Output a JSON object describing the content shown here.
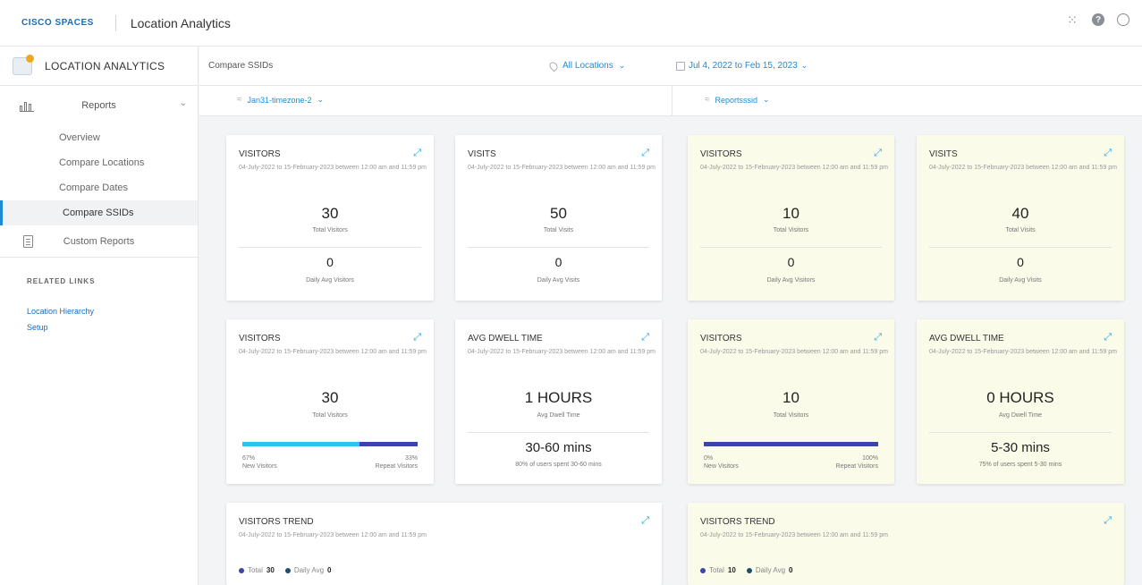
{
  "header": {
    "brand": "CISCO SPACES",
    "app_title": "Location Analytics"
  },
  "sidebar": {
    "title": "LOCATION ANALYTICS",
    "reports_label": "Reports",
    "sub_items": [
      "Overview",
      "Compare Locations",
      "Compare Dates",
      "Compare SSIDs"
    ],
    "active_item": "Compare SSIDs",
    "custom_reports": "Custom Reports",
    "related_links_heading": "RELATED LINKS",
    "links": [
      "Location Hierarchy",
      "Setup"
    ]
  },
  "filters": {
    "page_title": "Compare SSIDs",
    "location": "All Locations",
    "date_range": "Jul 4, 2022 to Feb 15, 2023",
    "ssid_left": "Jan31-timezone-2",
    "ssid_right": "Reportsssid"
  },
  "date_sub": "04-July-2022 to 15-February-2023 between 12:00 am and 11:59 pm",
  "cards_row1": [
    {
      "title": "VISITORS",
      "value": "30",
      "value_label": "Total Visitors",
      "avg": "0",
      "avg_label": "Daily Avg Visitors"
    },
    {
      "title": "VISITS",
      "value": "50",
      "value_label": "Total Visits",
      "avg": "0",
      "avg_label": "Daily Avg Visits"
    },
    {
      "title": "VISITORS",
      "value": "10",
      "value_label": "Total Visitors",
      "avg": "0",
      "avg_label": "Daily Avg Visitors"
    },
    {
      "title": "VISITS",
      "value": "40",
      "value_label": "Total Visits",
      "avg": "0",
      "avg_label": "Daily Avg Visits"
    }
  ],
  "cards_row2": [
    {
      "title": "VISITORS",
      "value": "30",
      "value_label": "Total Visitors",
      "new_pct": "67%",
      "repeat_pct": "33%",
      "new_fraction": 0.67,
      "new_label": "New Visitors",
      "repeat_label": "Repeat Visitors"
    },
    {
      "title": "AVG DWELL TIME",
      "value": "1 HOURS",
      "value_label": "Avg Dwell Time",
      "range": "30-60 mins",
      "range_note": "80% of users spent 30-60 mins"
    },
    {
      "title": "VISITORS",
      "value": "10",
      "value_label": "Total Visitors",
      "new_pct": "0%",
      "repeat_pct": "100%",
      "new_fraction": 0.0,
      "new_label": "New Visitors",
      "repeat_label": "Repeat Visitors"
    },
    {
      "title": "AVG DWELL TIME",
      "value": "0 HOURS",
      "value_label": "Avg Dwell Time",
      "range": "5-30 mins",
      "range_note": "75% of users spent 5-30 mins"
    }
  ],
  "trends": [
    {
      "title": "VISITORS TREND",
      "total_label": "Total",
      "total": "30",
      "avg_label": "Daily Avg",
      "avg": "0"
    },
    {
      "title": "VISITORS TREND",
      "total_label": "Total",
      "total": "10",
      "avg_label": "Daily Avg",
      "avg": "0"
    }
  ],
  "colors": {
    "accent": "#1f8ad6",
    "new_bar": "#25c7ea",
    "repeat_bar": "#3b44a8",
    "total_dot": "#3b44a8",
    "avg_dot": "#1e4d6e",
    "highlight_card": "#fbfbe9"
  }
}
